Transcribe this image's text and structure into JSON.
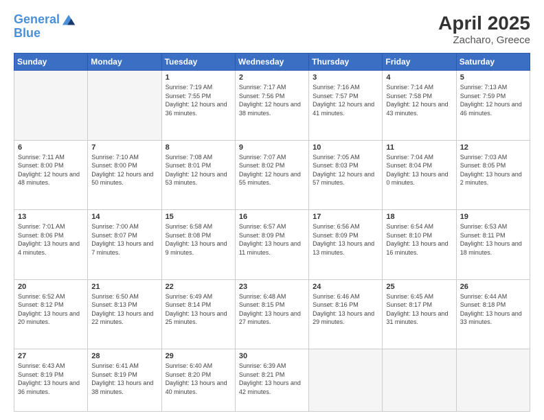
{
  "header": {
    "logo_line1": "General",
    "logo_line2": "Blue",
    "month_year": "April 2025",
    "location": "Zacharo, Greece"
  },
  "days_of_week": [
    "Sunday",
    "Monday",
    "Tuesday",
    "Wednesday",
    "Thursday",
    "Friday",
    "Saturday"
  ],
  "weeks": [
    [
      {
        "day": "",
        "info": ""
      },
      {
        "day": "",
        "info": ""
      },
      {
        "day": "1",
        "info": "Sunrise: 7:19 AM\nSunset: 7:55 PM\nDaylight: 12 hours and 36 minutes."
      },
      {
        "day": "2",
        "info": "Sunrise: 7:17 AM\nSunset: 7:56 PM\nDaylight: 12 hours and 38 minutes."
      },
      {
        "day": "3",
        "info": "Sunrise: 7:16 AM\nSunset: 7:57 PM\nDaylight: 12 hours and 41 minutes."
      },
      {
        "day": "4",
        "info": "Sunrise: 7:14 AM\nSunset: 7:58 PM\nDaylight: 12 hours and 43 minutes."
      },
      {
        "day": "5",
        "info": "Sunrise: 7:13 AM\nSunset: 7:59 PM\nDaylight: 12 hours and 46 minutes."
      }
    ],
    [
      {
        "day": "6",
        "info": "Sunrise: 7:11 AM\nSunset: 8:00 PM\nDaylight: 12 hours and 48 minutes."
      },
      {
        "day": "7",
        "info": "Sunrise: 7:10 AM\nSunset: 8:00 PM\nDaylight: 12 hours and 50 minutes."
      },
      {
        "day": "8",
        "info": "Sunrise: 7:08 AM\nSunset: 8:01 PM\nDaylight: 12 hours and 53 minutes."
      },
      {
        "day": "9",
        "info": "Sunrise: 7:07 AM\nSunset: 8:02 PM\nDaylight: 12 hours and 55 minutes."
      },
      {
        "day": "10",
        "info": "Sunrise: 7:05 AM\nSunset: 8:03 PM\nDaylight: 12 hours and 57 minutes."
      },
      {
        "day": "11",
        "info": "Sunrise: 7:04 AM\nSunset: 8:04 PM\nDaylight: 13 hours and 0 minutes."
      },
      {
        "day": "12",
        "info": "Sunrise: 7:03 AM\nSunset: 8:05 PM\nDaylight: 13 hours and 2 minutes."
      }
    ],
    [
      {
        "day": "13",
        "info": "Sunrise: 7:01 AM\nSunset: 8:06 PM\nDaylight: 13 hours and 4 minutes."
      },
      {
        "day": "14",
        "info": "Sunrise: 7:00 AM\nSunset: 8:07 PM\nDaylight: 13 hours and 7 minutes."
      },
      {
        "day": "15",
        "info": "Sunrise: 6:58 AM\nSunset: 8:08 PM\nDaylight: 13 hours and 9 minutes."
      },
      {
        "day": "16",
        "info": "Sunrise: 6:57 AM\nSunset: 8:09 PM\nDaylight: 13 hours and 11 minutes."
      },
      {
        "day": "17",
        "info": "Sunrise: 6:56 AM\nSunset: 8:09 PM\nDaylight: 13 hours and 13 minutes."
      },
      {
        "day": "18",
        "info": "Sunrise: 6:54 AM\nSunset: 8:10 PM\nDaylight: 13 hours and 16 minutes."
      },
      {
        "day": "19",
        "info": "Sunrise: 6:53 AM\nSunset: 8:11 PM\nDaylight: 13 hours and 18 minutes."
      }
    ],
    [
      {
        "day": "20",
        "info": "Sunrise: 6:52 AM\nSunset: 8:12 PM\nDaylight: 13 hours and 20 minutes."
      },
      {
        "day": "21",
        "info": "Sunrise: 6:50 AM\nSunset: 8:13 PM\nDaylight: 13 hours and 22 minutes."
      },
      {
        "day": "22",
        "info": "Sunrise: 6:49 AM\nSunset: 8:14 PM\nDaylight: 13 hours and 25 minutes."
      },
      {
        "day": "23",
        "info": "Sunrise: 6:48 AM\nSunset: 8:15 PM\nDaylight: 13 hours and 27 minutes."
      },
      {
        "day": "24",
        "info": "Sunrise: 6:46 AM\nSunset: 8:16 PM\nDaylight: 13 hours and 29 minutes."
      },
      {
        "day": "25",
        "info": "Sunrise: 6:45 AM\nSunset: 8:17 PM\nDaylight: 13 hours and 31 minutes."
      },
      {
        "day": "26",
        "info": "Sunrise: 6:44 AM\nSunset: 8:18 PM\nDaylight: 13 hours and 33 minutes."
      }
    ],
    [
      {
        "day": "27",
        "info": "Sunrise: 6:43 AM\nSunset: 8:19 PM\nDaylight: 13 hours and 36 minutes."
      },
      {
        "day": "28",
        "info": "Sunrise: 6:41 AM\nSunset: 8:19 PM\nDaylight: 13 hours and 38 minutes."
      },
      {
        "day": "29",
        "info": "Sunrise: 6:40 AM\nSunset: 8:20 PM\nDaylight: 13 hours and 40 minutes."
      },
      {
        "day": "30",
        "info": "Sunrise: 6:39 AM\nSunset: 8:21 PM\nDaylight: 13 hours and 42 minutes."
      },
      {
        "day": "",
        "info": ""
      },
      {
        "day": "",
        "info": ""
      },
      {
        "day": "",
        "info": ""
      }
    ]
  ]
}
